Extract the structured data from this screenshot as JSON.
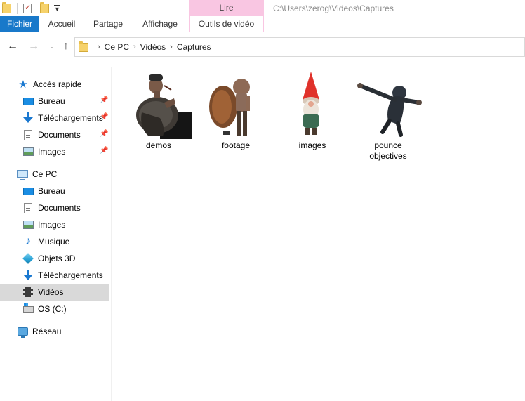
{
  "window": {
    "title_path": "C:\\Users\\zerog\\Videos\\Captures",
    "context_tab_group": "Lire"
  },
  "quick_access_toolbar": {
    "icons": [
      "folder-icon",
      "properties-icon",
      "new-folder-icon",
      "customize-dropdown-icon"
    ]
  },
  "ribbon": {
    "tabs": [
      {
        "label": "Fichier",
        "active": true
      },
      {
        "label": "Accueil"
      },
      {
        "label": "Partage"
      },
      {
        "label": "Affichage"
      },
      {
        "label": "Outils de vidéo"
      }
    ]
  },
  "address_bar": {
    "crumbs": [
      "Ce PC",
      "Vidéos",
      "Captures"
    ]
  },
  "sidebar": {
    "quick_access": {
      "label": "Accès rapide",
      "items": [
        {
          "label": "Bureau",
          "icon": "desktop-icon",
          "pinned": true
        },
        {
          "label": "Téléchargements",
          "icon": "download-icon",
          "pinned": true
        },
        {
          "label": "Documents",
          "icon": "documents-icon",
          "pinned": true
        },
        {
          "label": "Images",
          "icon": "images-icon",
          "pinned": true
        }
      ]
    },
    "this_pc": {
      "label": "Ce PC",
      "items": [
        {
          "label": "Bureau",
          "icon": "desktop-icon"
        },
        {
          "label": "Documents",
          "icon": "documents-icon"
        },
        {
          "label": "Images",
          "icon": "images-icon"
        },
        {
          "label": "Musique",
          "icon": "music-icon"
        },
        {
          "label": "Objets 3D",
          "icon": "3d-objects-icon"
        },
        {
          "label": "Téléchargements",
          "icon": "download-icon"
        },
        {
          "label": "Vidéos",
          "icon": "videos-icon",
          "selected": true
        },
        {
          "label": "OS (C:)",
          "icon": "drive-icon"
        }
      ]
    },
    "network": {
      "label": "Réseau"
    }
  },
  "content": {
    "items": [
      {
        "name": "demos",
        "thumbnail": "survivor-lying-thumbnail"
      },
      {
        "name": "footage",
        "thumbnail": "charger-thumbnail"
      },
      {
        "name": "images",
        "thumbnail": "gnome-thumbnail"
      },
      {
        "name": "pounce objectives",
        "thumbnail": "hunter-thumbnail"
      }
    ]
  },
  "colors": {
    "file_tab": "#1979ca",
    "context_tab": "#f9c6e2",
    "selected_item": "#d9d9d9"
  }
}
